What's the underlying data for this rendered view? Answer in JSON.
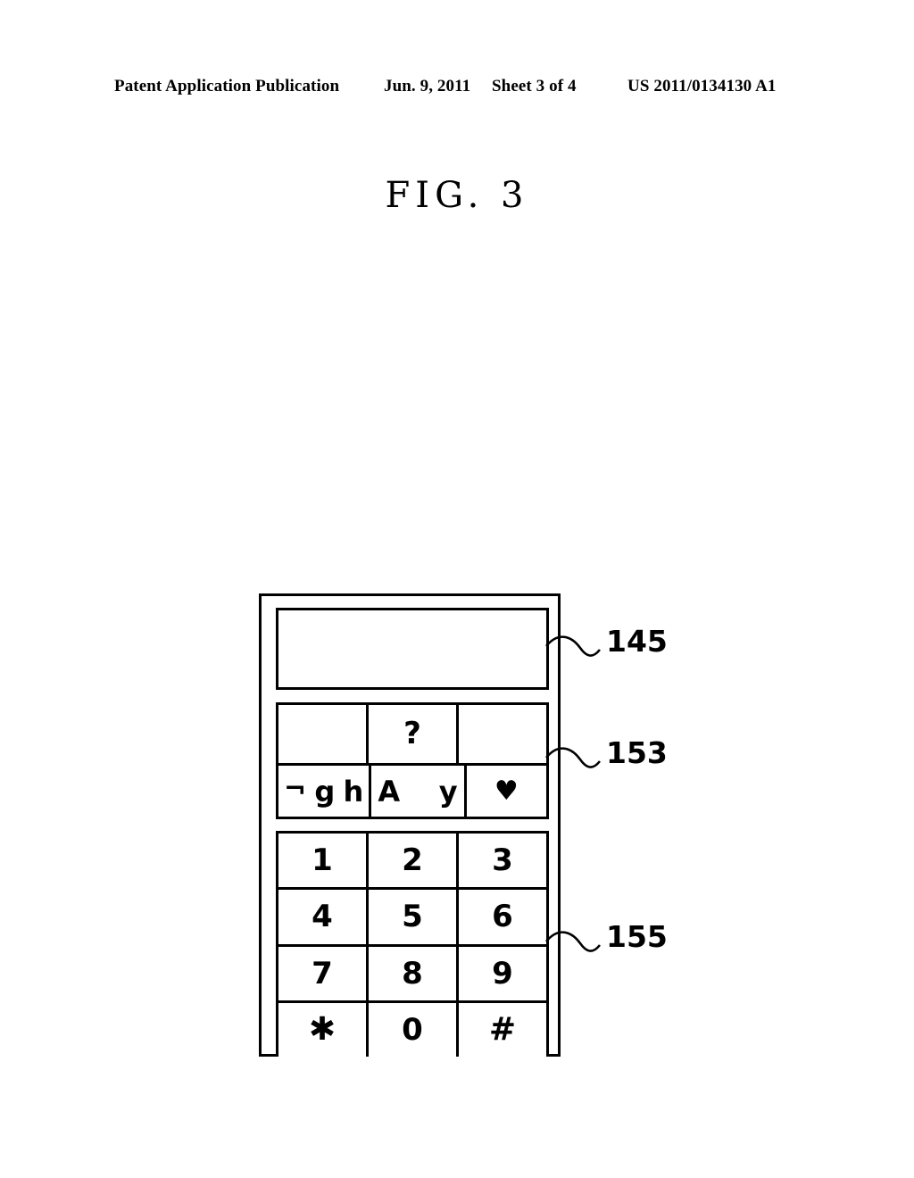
{
  "header": {
    "publication": "Patent Application Publication",
    "date": "Jun. 9, 2011",
    "sheet": "Sheet 3 of 4",
    "patent_number": "US 2011/0134130 A1"
  },
  "figure": {
    "title": "FIG. 3"
  },
  "device": {
    "display": {
      "ref": "145",
      "content": ""
    },
    "character_area": {
      "ref": "153",
      "rows": [
        {
          "cells": [
            {
              "glyphs": []
            },
            {
              "glyphs": [
                "?"
              ]
            },
            {
              "glyphs": []
            }
          ]
        },
        {
          "cells": [
            {
              "glyphs": [
                "¬",
                "g",
                "h"
              ]
            },
            {
              "glyphs": [
                "A",
                "y"
              ]
            },
            {
              "glyphs": [
                "♥"
              ]
            }
          ]
        }
      ]
    },
    "keypad": {
      "ref": "155",
      "rows": [
        [
          "1",
          "2",
          "3"
        ],
        [
          "4",
          "5",
          "6"
        ],
        [
          "7",
          "8",
          "9"
        ],
        [
          "✱",
          "0",
          "#"
        ]
      ]
    }
  },
  "colors": {
    "line": "#000000",
    "background": "#ffffff"
  }
}
